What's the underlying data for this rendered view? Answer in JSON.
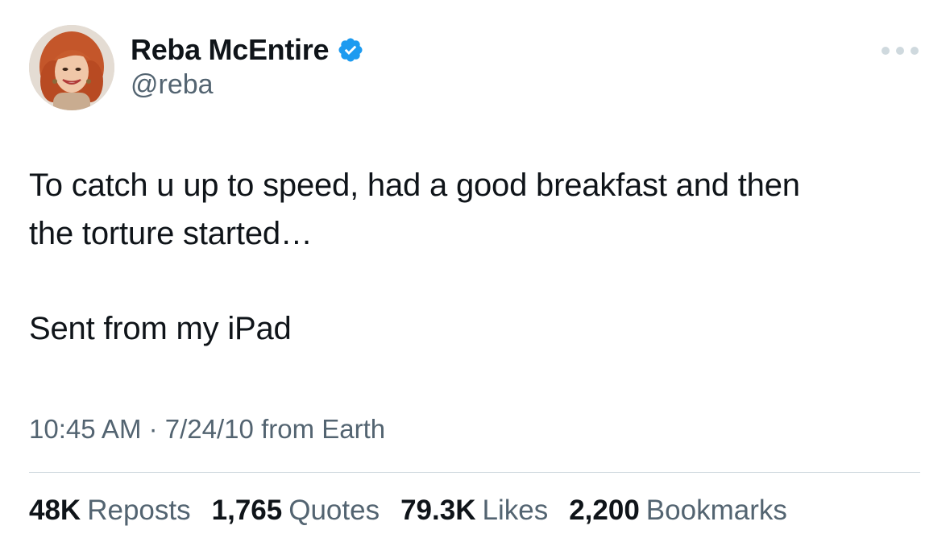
{
  "author": {
    "display_name": "Reba McEntire",
    "handle": "@reba",
    "verified": true,
    "verified_color": "#1d9bf0"
  },
  "tweet": {
    "line1": "To catch u up to speed, had a good breakfast and then",
    "line2": "the torture started…",
    "line3": "Sent from my iPad"
  },
  "meta": {
    "time": "10:45 AM",
    "separator": "·",
    "date": "7/24/10",
    "source": "from Earth"
  },
  "stats": {
    "reposts_count": "48K",
    "reposts_label": "Reposts",
    "quotes_count": "1,765",
    "quotes_label": "Quotes",
    "likes_count": "79.3K",
    "likes_label": "Likes",
    "bookmarks_count": "2,200",
    "bookmarks_label": "Bookmarks"
  },
  "icons": {
    "verified": "verified-badge-icon",
    "more": "more-options-icon"
  }
}
